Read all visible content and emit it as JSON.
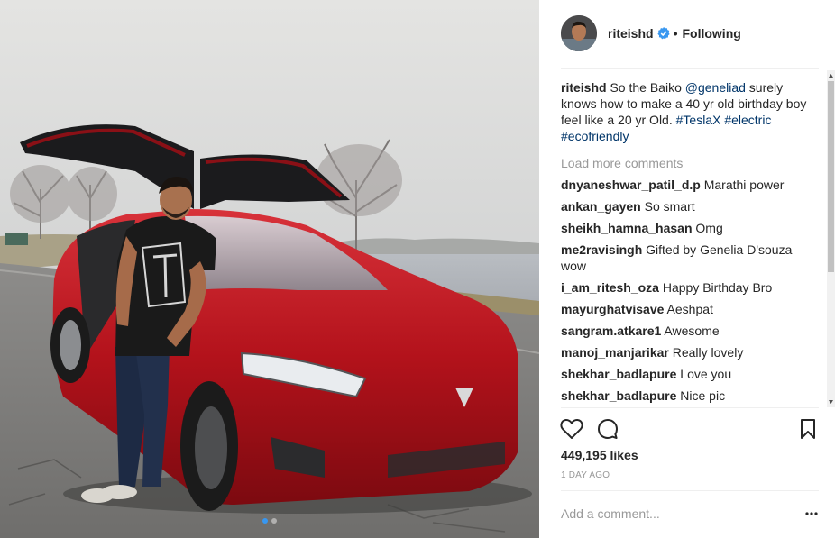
{
  "post": {
    "author": "riteishd",
    "verified": true,
    "follow_separator": "•",
    "follow_state": "Following",
    "caption_user": "riteishd",
    "caption_text": "So the Baiko",
    "caption_mention": "@geneliad",
    "caption_text_2": "surely knows how to make a 40 yr old birthday boy feel like a 20 yr Old.",
    "caption_tags": [
      "#TeslaX",
      "#electric",
      "#ecofriendly"
    ],
    "load_more": "Load more comments",
    "comments": [
      {
        "user": "dnyaneshwar_patil_d.p",
        "text": "Marathi power"
      },
      {
        "user": "ankan_gayen",
        "text": "So smart"
      },
      {
        "user": "sheikh_hamna_hasan",
        "text": "Omg"
      },
      {
        "user": "me2ravisingh",
        "text": "Gifted by Genelia D'souza wow"
      },
      {
        "user": "i_am_ritesh_oza",
        "text": "Happy Birthday Bro"
      },
      {
        "user": "mayurghatvisave",
        "text": "Aeshpat"
      },
      {
        "user": "sangram.atkare1",
        "text": "Awesome"
      },
      {
        "user": "manoj_manjarikar",
        "text": "Really lovely"
      },
      {
        "user": "shekhar_badlapure",
        "text": "Love you"
      },
      {
        "user": "shekhar_badlapure",
        "text": "Nice pic"
      }
    ],
    "likes": "449,195 likes",
    "time_ago": "1 DAY AGO",
    "comment_placeholder": "Add a comment...",
    "carousel": {
      "count": 2,
      "active_index": 0
    }
  },
  "icons": {
    "like": "heart-icon",
    "comment": "comment-bubble-icon",
    "save": "bookmark-icon",
    "options": "more-options-icon",
    "verified": "verified-badge-icon"
  },
  "colors": {
    "verified_blue": "#3897f0",
    "link_blue": "#003569",
    "muted": "#999999",
    "text": "#262626",
    "car_red": "#b3121b"
  }
}
